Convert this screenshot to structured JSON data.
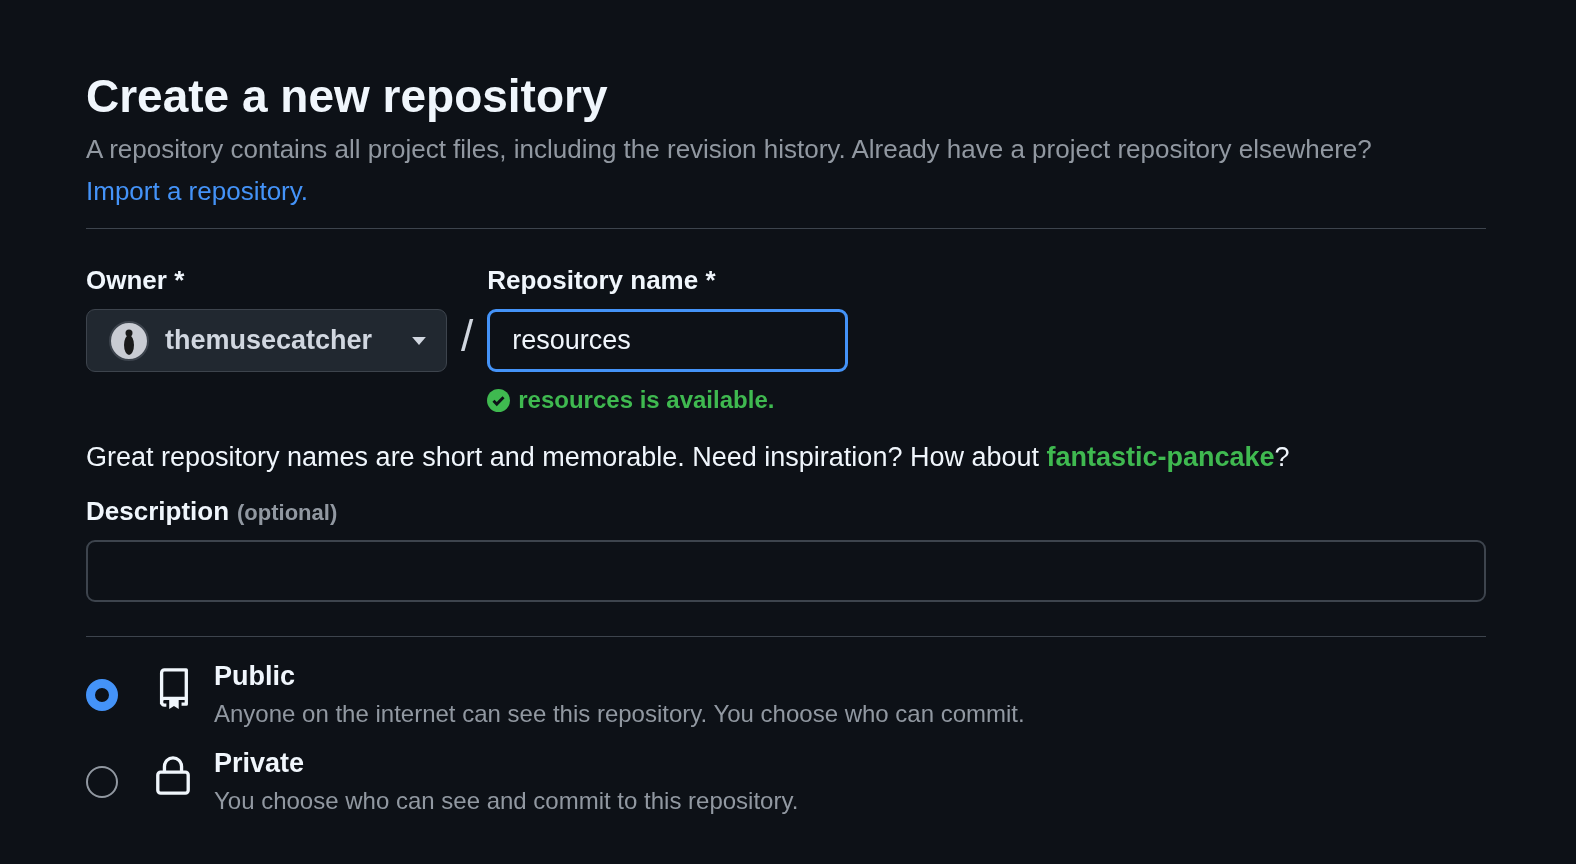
{
  "heading": "Create a new repository",
  "intro": {
    "text": "A repository contains all project files, including the revision history. Already have a project repository elsewhere?",
    "link": "Import a repository."
  },
  "owner": {
    "label": "Owner *",
    "value": "themusecatcher"
  },
  "separator": "/",
  "repo_name": {
    "label": "Repository name *",
    "value": "resources",
    "focused": true
  },
  "availability": "resources is available.",
  "suggestion": {
    "before": "Great repository names are short and memorable. Need inspiration? How about ",
    "link": "fantastic-pancake",
    "after": "?"
  },
  "description": {
    "label": "Description",
    "hint": "(optional)"
  },
  "visibility": [
    {
      "kind": "public",
      "label": "Public",
      "text": "Anyone on the internet can see this repository. You choose who can commit.",
      "selected": true
    },
    {
      "kind": "private",
      "label": "Private",
      "text": "You choose who can see and commit to this repository.",
      "selected": false
    }
  ]
}
